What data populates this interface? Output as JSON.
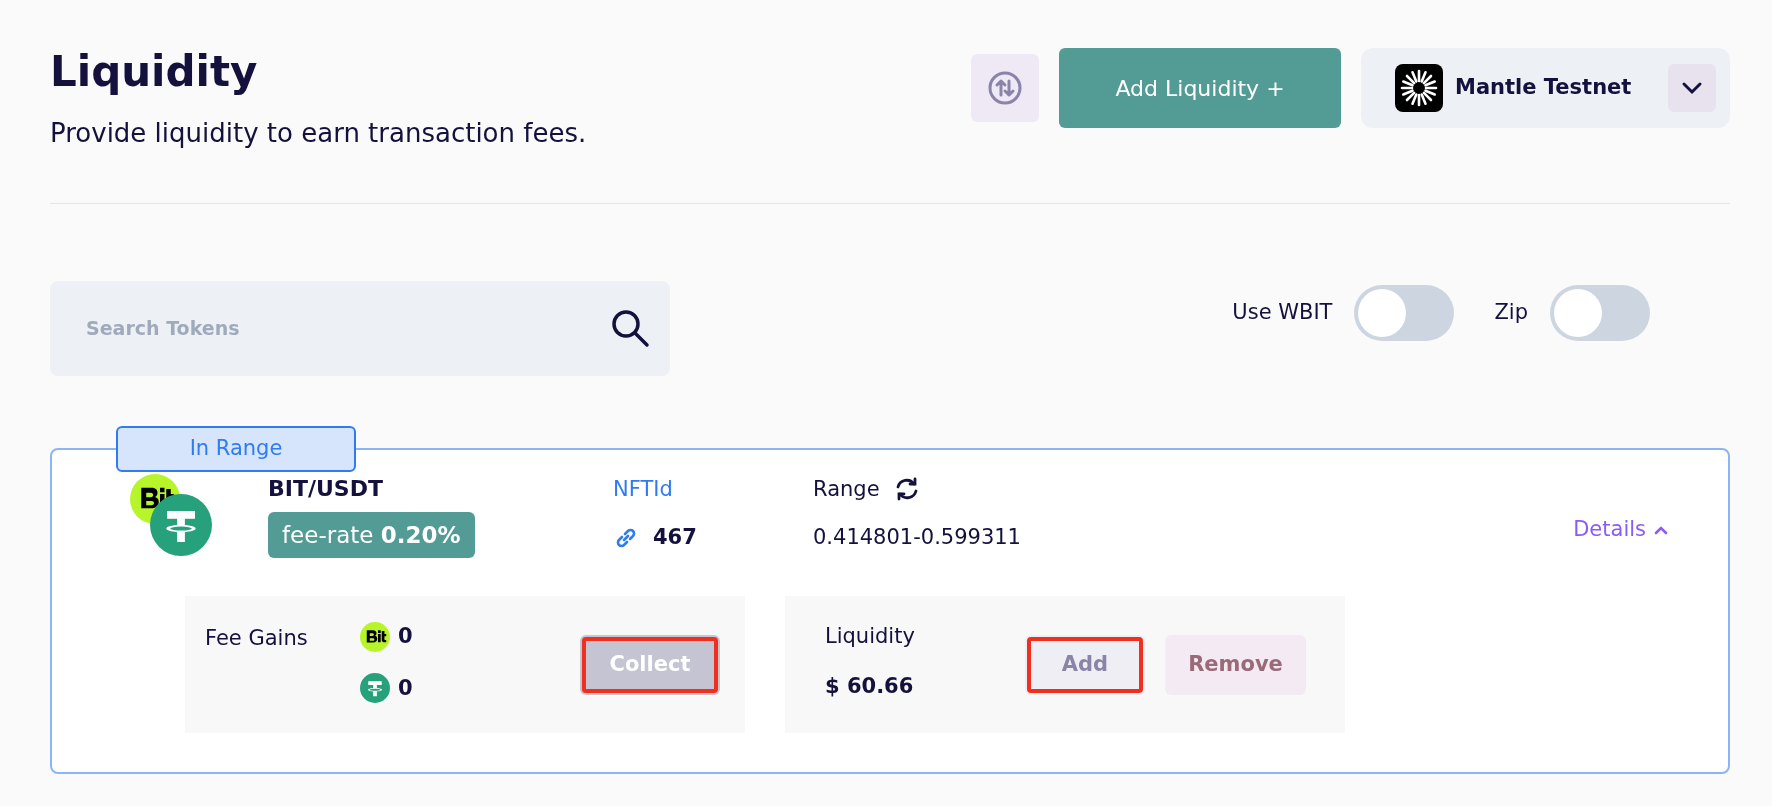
{
  "header": {
    "title": "Liquidity",
    "subtitle": "Provide liquidity to earn transaction fees.",
    "add_button": "Add Liquidity +",
    "network": "Mantle Testnet"
  },
  "search": {
    "placeholder": "Search Tokens"
  },
  "toggles": [
    {
      "label": "Use WBIT",
      "on": false
    },
    {
      "label": "Zip",
      "on": false
    }
  ],
  "positions": [
    {
      "status": "In Range",
      "pair": "BIT/USDT",
      "fee_label": "fee-rate",
      "fee_value": "0.20%",
      "nft_label": "NFTId",
      "nft_id": "467",
      "range_label": "Range",
      "range": "0.414801-0.599311",
      "details": "Details",
      "expanded": true,
      "fee_gains_label": "Fee Gains",
      "gains": [
        {
          "kind": "bit",
          "amount": "0"
        },
        {
          "kind": "usdt",
          "amount": "0"
        }
      ],
      "collect": {
        "label": "Collect",
        "highlighted": true
      },
      "liquidity_label": "Liquidity",
      "liquidity": "$ 60.66",
      "add": {
        "label": "Add",
        "highlighted": true
      },
      "remove": {
        "label": "Remove",
        "highlighted": false
      }
    }
  ]
}
